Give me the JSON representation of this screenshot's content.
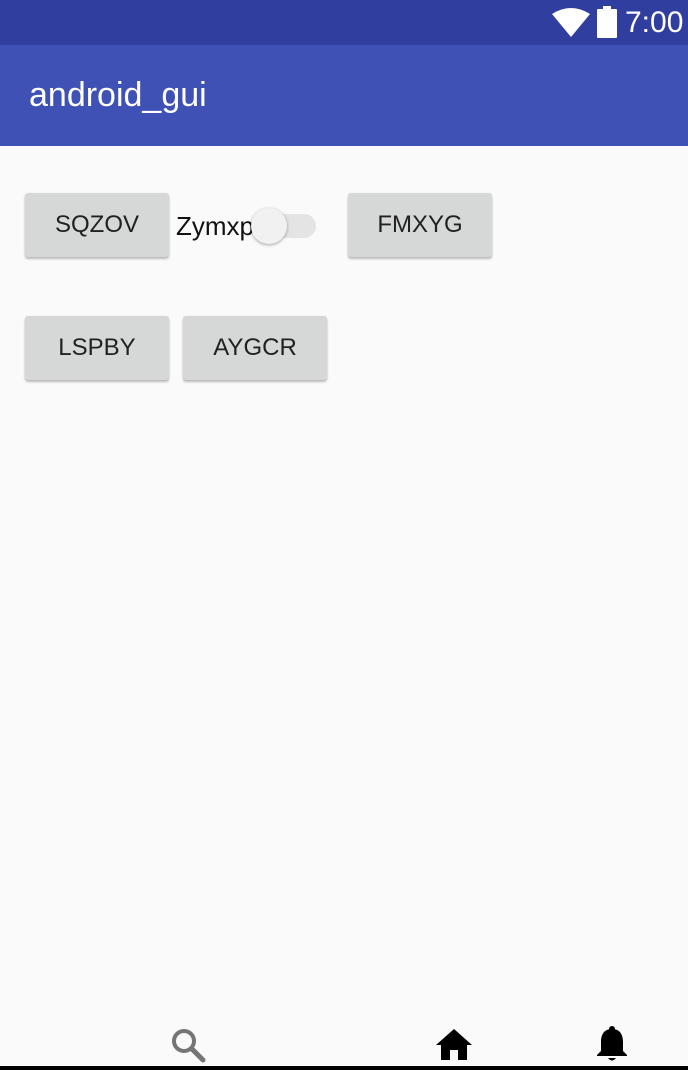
{
  "status_bar": {
    "time": "7:00",
    "wifi_icon": "wifi-icon",
    "battery_icon": "battery-icon",
    "color": "#303f9f"
  },
  "app_bar": {
    "title": "android_gui",
    "color": "#3f51b5"
  },
  "buttons": {
    "sqzov": "SQZOV",
    "fmxyg": "FMXYG",
    "lspby": "LSPBY",
    "aygcr": "AYGCR"
  },
  "switch": {
    "label": "Zymxp",
    "checked": false
  },
  "bottom_nav": {
    "items": [
      {
        "icon": "search-icon"
      },
      {
        "icon": "home-icon"
      },
      {
        "icon": "bell-icon"
      }
    ]
  }
}
